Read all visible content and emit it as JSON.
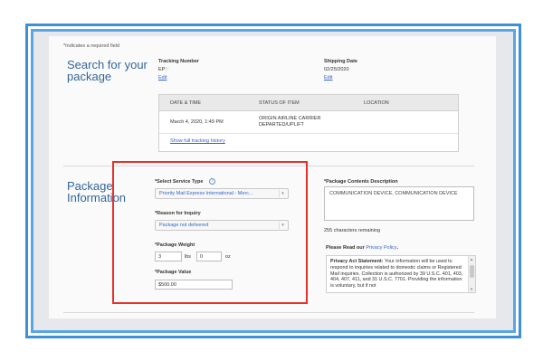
{
  "form": {
    "required_note": "*Indicates a required field",
    "search_section_title": "Search for your package",
    "search_section_title_line1": "Search for your",
    "search_section_title_line2": "package",
    "tracking_number_label": "Tracking Number",
    "tracking_number_value": "EP85        0US",
    "tracking_edit_link": "Edit",
    "shipping_date_label": "Shipping Date",
    "shipping_date_value": "02/25/2020",
    "shipping_edit_link": "Edit"
  },
  "tracking_table": {
    "headers": [
      "DATE & TIME",
      "STATUS OF ITEM",
      "LOCATION"
    ],
    "rows": [
      {
        "date_time": "March 4, 2020, 1:49 PM",
        "status_line1": "ORIGIN AIRLINE CARRIER",
        "status_line2": "DEPARTED/UPLIFT",
        "location": ""
      }
    ],
    "history_link": "Show full tracking history"
  },
  "package_info": {
    "section_title_line1": "Package",
    "section_title_line2": "Information",
    "service_type_label": "*Select Service Type",
    "service_type_value": "Priority Mail Express International - Merc...",
    "reason_label": "*Reason for Inquiry",
    "reason_value": "Package not delivered",
    "weight_label": "*Package Weight",
    "weight_lbs": "3",
    "weight_lbs_unit": "lbs",
    "weight_oz": "0",
    "weight_oz_unit": "oz",
    "value_label": "*Package Value",
    "value_value": "$500.00"
  },
  "contents": {
    "label": "*Package Contents Description",
    "value": "COMMUNICATION DEVICE, COMMUNICATION DEVICE",
    "chars_remaining": "255 characters remaining"
  },
  "privacy": {
    "read_our": "Please Read our ",
    "policy_link": "Privacy Policy",
    "period": ".",
    "statement_bold": "Privacy Act Statement:",
    "statement_text": " Your information will be used to respond to inquiries related to domestic claims or Registered Mail inquiries. Collection is authorized by 39 U.S.C. 401, 403, 404, 407, 411, and 31 U.S.C. 7701. Providing the information is voluntary, but if not"
  },
  "colors": {
    "frame_blue": "#3d8fd6",
    "title_blue": "#336699",
    "link_blue": "#3366cc",
    "highlight_red": "#e8302a"
  }
}
